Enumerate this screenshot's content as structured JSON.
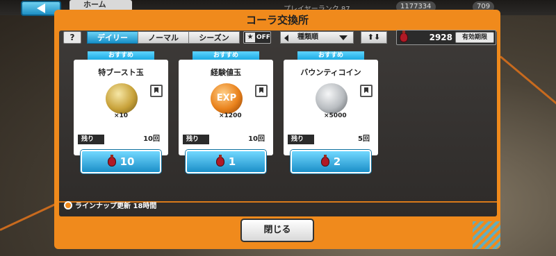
{
  "topbar": {
    "home_label": "ホーム",
    "player_rank": "プレイヤーランク 87",
    "stat_1": "1177334",
    "stat_2": "709"
  },
  "dialog": {
    "title": "コーラ交換所",
    "tabs": [
      {
        "label": "デイリー",
        "active": true
      },
      {
        "label": "ノーマル",
        "active": false
      },
      {
        "label": "シーズン",
        "active": false
      }
    ],
    "help_label": "?",
    "fav_toggle_label": "OFF",
    "sort_label": "種類順",
    "currency_value": "2928",
    "expiry_label": "有効期限",
    "items": [
      {
        "tag": "おすすめ",
        "name": "特ブースト玉",
        "qty": "×10",
        "remain_label": "残り",
        "remain_value": "10回",
        "price": "10",
        "art_color": "#c8a23a"
      },
      {
        "tag": "おすすめ",
        "name": "経験値玉",
        "qty": "×1200",
        "remain_label": "残り",
        "remain_value": "10回",
        "price": "1",
        "art_color": "#e9821c"
      },
      {
        "tag": "おすすめ",
        "name": "バウンティコイン",
        "qty": "×5000",
        "remain_label": "残り",
        "remain_value": "5回",
        "price": "2",
        "art_color": "#b8bcc0"
      }
    ],
    "lineup_text": "ラインナップ更新 18時間",
    "close_label": "閉じる"
  },
  "colors": {
    "dialog_orange": "#f08a1c",
    "tab_active": "#1890c8",
    "panel_dark": "#2e2b29"
  }
}
